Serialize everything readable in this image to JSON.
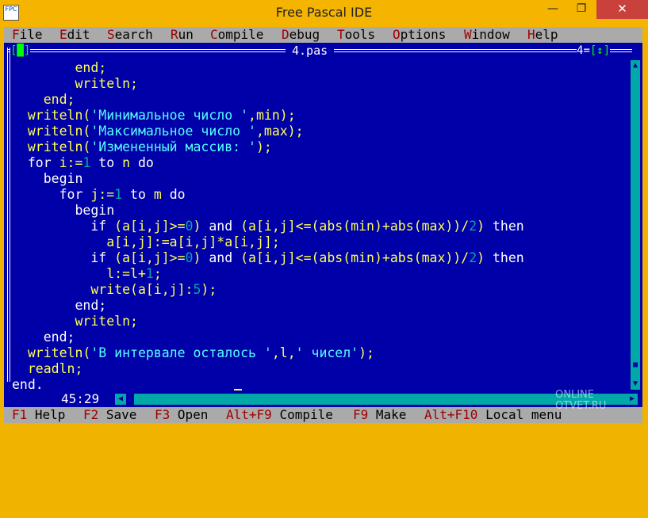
{
  "window": {
    "title": "Free Pascal IDE",
    "icon_text": "FPC",
    "minimize": "—",
    "maximize": "❐",
    "close": "✕"
  },
  "menu": [
    {
      "hot": "F",
      "rest": "ile"
    },
    {
      "hot": "E",
      "rest": "dit"
    },
    {
      "hot": "S",
      "rest": "earch"
    },
    {
      "hot": "R",
      "rest": "un"
    },
    {
      "hot": "C",
      "rest": "ompile"
    },
    {
      "hot": "D",
      "rest": "ebug"
    },
    {
      "hot": "T",
      "rest": "ools"
    },
    {
      "hot": "O",
      "rest": "ptions"
    },
    {
      "hot": "W",
      "rest": "indow"
    },
    {
      "hot": "H",
      "rest": "elp"
    }
  ],
  "editor": {
    "filename": "4.pas",
    "close_box": "[█]",
    "window_number": "4",
    "zoom_box": "[↕]",
    "cursor_position": "45:29"
  },
  "code_lines": [
    [
      [
        "p",
        "        end;"
      ]
    ],
    [
      [
        "p",
        "        writeln;"
      ]
    ],
    [
      [
        "p",
        "    end;"
      ]
    ],
    [
      [
        "p",
        "  writeln("
      ],
      [
        "s",
        "'Минимальное число '"
      ],
      [
        "p",
        ",min);"
      ]
    ],
    [
      [
        "p",
        "  writeln("
      ],
      [
        "s",
        "'Максимальное число '"
      ],
      [
        "p",
        ",max);"
      ]
    ],
    [
      [
        "p",
        "  writeln("
      ],
      [
        "s",
        "'Измененный массив: '"
      ],
      [
        "p",
        ");"
      ]
    ],
    [
      [
        "k",
        "  for "
      ],
      [
        "p",
        "i:="
      ],
      [
        "n",
        "1"
      ],
      [
        "k",
        " to "
      ],
      [
        "p",
        "n"
      ],
      [
        "k",
        " do"
      ]
    ],
    [
      [
        "k",
        "    begin"
      ]
    ],
    [
      [
        "k",
        "      for "
      ],
      [
        "p",
        "j:="
      ],
      [
        "n",
        "1"
      ],
      [
        "k",
        " to "
      ],
      [
        "p",
        "m"
      ],
      [
        "k",
        " do"
      ]
    ],
    [
      [
        "k",
        "        begin"
      ]
    ],
    [
      [
        "k",
        "          if "
      ],
      [
        "p",
        "(a[i,j]>="
      ],
      [
        "n",
        "0"
      ],
      [
        "p",
        ")"
      ],
      [
        "k",
        " and "
      ],
      [
        "p",
        "(a[i,j]<=(abs(min)+abs(max))/"
      ],
      [
        "n",
        "2"
      ],
      [
        "p",
        ")"
      ],
      [
        "k",
        " then"
      ]
    ],
    [
      [
        "p",
        "            a[i,j]:=a[i,j]*a[i,j];"
      ]
    ],
    [
      [
        "k",
        "          if "
      ],
      [
        "p",
        "(a[i,j]>="
      ],
      [
        "n",
        "0"
      ],
      [
        "p",
        ")"
      ],
      [
        "k",
        " and "
      ],
      [
        "p",
        "(a[i,j]<=(abs(min)+abs(max))/"
      ],
      [
        "n",
        "2"
      ],
      [
        "p",
        ")"
      ],
      [
        "k",
        " then"
      ]
    ],
    [
      [
        "p",
        "            l:=l+"
      ],
      [
        "n",
        "1"
      ],
      [
        "p",
        ";"
      ]
    ],
    [
      [
        "p",
        "          write(a[i,j]:"
      ],
      [
        "n",
        "5"
      ],
      [
        "p",
        ");"
      ]
    ],
    [
      [
        "k",
        "        end;"
      ]
    ],
    [
      [
        "p",
        "        writeln;"
      ]
    ],
    [
      [
        "k",
        "    end;"
      ]
    ],
    [
      [
        "p",
        "  writeln("
      ],
      [
        "s",
        "'В интервале осталось '"
      ],
      [
        "p",
        ",l,"
      ],
      [
        "s",
        "' чисел'"
      ],
      [
        "p",
        ");"
      ]
    ],
    [
      [
        "p",
        "  readln;"
      ]
    ],
    [
      [
        "k",
        "end."
      ]
    ]
  ],
  "status": [
    {
      "key": "F1",
      "label": "Help"
    },
    {
      "key": "F2",
      "label": "Save"
    },
    {
      "key": "F3",
      "label": "Open"
    },
    {
      "key": "Alt+F9",
      "label": "Compile"
    },
    {
      "key": "F9",
      "label": "Make"
    },
    {
      "key": "Alt+F10",
      "label": "Local menu"
    }
  ],
  "watermark": {
    "line1": "ONLINE",
    "line2": "OTVET.RU"
  },
  "colors": {
    "editor_bg": "#0000a8",
    "text_default": "#ffff55",
    "string": "#55ffff",
    "number": "#00aaaa",
    "keyword": "#ffffff",
    "hotkey": "#a00000",
    "titlebar": "#f4b400",
    "close_button": "#c8413b"
  }
}
